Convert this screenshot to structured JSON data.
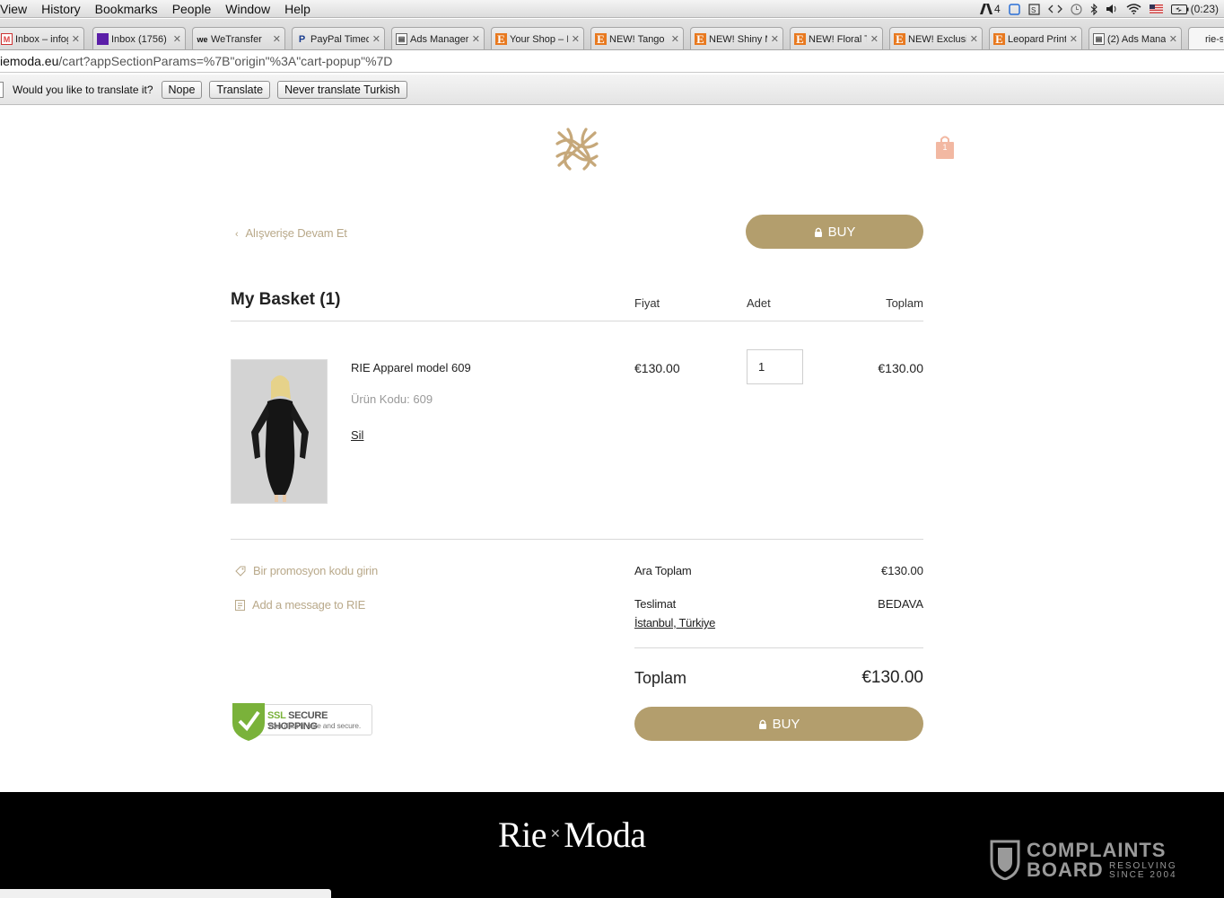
{
  "menubar": {
    "items": [
      "View",
      "History",
      "Bookmarks",
      "People",
      "Window",
      "Help"
    ],
    "status": {
      "adobe_count": "4",
      "battery_time": "(0:23)"
    }
  },
  "tabs": [
    {
      "title": "Inbox – infog",
      "favicon": "gmail-icon"
    },
    {
      "title": "Inbox (1756)",
      "favicon": "yahoo-icon"
    },
    {
      "title": "WeTransfer",
      "favicon": "wetransfer-icon"
    },
    {
      "title": "PayPal Timed",
      "favicon": "paypal-icon"
    },
    {
      "title": "Ads Manager",
      "favicon": "page-icon"
    },
    {
      "title": "Your Shop – I",
      "favicon": "etsy-icon"
    },
    {
      "title": "NEW! Tango c",
      "favicon": "etsy-icon"
    },
    {
      "title": "NEW! Shiny M",
      "favicon": "etsy-icon"
    },
    {
      "title": "NEW! Floral T",
      "favicon": "etsy-icon"
    },
    {
      "title": "NEW! Exclusi",
      "favicon": "etsy-icon"
    },
    {
      "title": "Leopard Print",
      "favicon": "etsy-icon"
    },
    {
      "title": "(2) Ads Mana",
      "favicon": "page-icon"
    },
    {
      "title": "rie-s",
      "favicon": ""
    }
  ],
  "address": {
    "host": "iemoda.eu",
    "path": "/cart?appSectionParams=%7B\"origin\"%3A\"cart-popup\"%7D"
  },
  "translate": {
    "prompt": "Would you like to translate it?",
    "nope": "Nope",
    "translate": "Translate",
    "never": "Never translate Turkish"
  },
  "header": {
    "cart_count": "1"
  },
  "cart": {
    "continue_label": "Alışverişe Devam Et",
    "buy_label": "BUY",
    "title": "My Basket (1)",
    "columns": {
      "price": "Fiyat",
      "qty": "Adet",
      "total": "Toplam"
    },
    "item": {
      "name": "RIE Apparel model 609",
      "code": "Ürün Kodu: 609",
      "remove_label": "Sil",
      "price": "€130.00",
      "quantity": "1",
      "total": "€130.00"
    },
    "promo_label": "Bir promosyon kodu girin",
    "message_label": "Add a message to RIE",
    "summary": {
      "subtotal_label": "Ara Toplam",
      "subtotal": "€130.00",
      "shipping_label": "Teslimat",
      "shipping_value": "BEDAVA",
      "shipping_location": "İstanbul, Türkiye",
      "total_label": "Toplam",
      "total": "€130.00"
    },
    "ssl": {
      "line1_green": "SSL",
      "line1": "SECURE SHOPPING",
      "line2": "Your data is safe and secure."
    }
  },
  "footer": {
    "brand_left": "Rie",
    "brand_right": "Moda",
    "watermark": {
      "line1": "COMPLAINTS",
      "line2": "BOARD",
      "small1": "RESOLVING",
      "small2": "SINCE 2004"
    }
  },
  "colors": {
    "accent": "#b39e6d",
    "link": "#b9a98a",
    "footer": "#000000",
    "cart_icon": "#f2b8a2"
  }
}
